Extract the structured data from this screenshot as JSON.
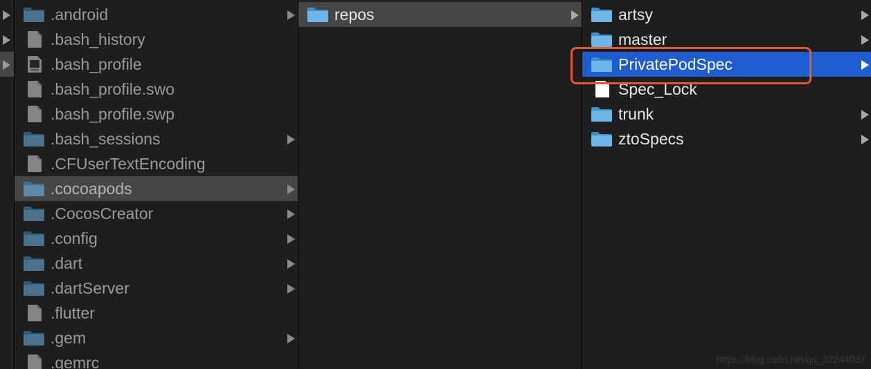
{
  "parent_column": {
    "items": [
      {
        "expandable": true,
        "selected": false
      },
      {
        "expandable": true,
        "selected": false
      },
      {
        "expandable": true,
        "selected": true
      }
    ]
  },
  "home_column": {
    "items": [
      {
        "name": ".android",
        "icon": "folder-icon",
        "expandable": true,
        "selected": false
      },
      {
        "name": ".bash_history",
        "icon": "document-icon",
        "expandable": false,
        "selected": false
      },
      {
        "name": ".bash_profile",
        "icon": "shell-script-icon",
        "expandable": false,
        "selected": false
      },
      {
        "name": ".bash_profile.swo",
        "icon": "document-icon",
        "expandable": false,
        "selected": false
      },
      {
        "name": ".bash_profile.swp",
        "icon": "document-icon",
        "expandable": false,
        "selected": false
      },
      {
        "name": ".bash_sessions",
        "icon": "folder-icon",
        "expandable": true,
        "selected": false
      },
      {
        "name": ".CFUserTextEncoding",
        "icon": "document-icon",
        "expandable": false,
        "selected": false
      },
      {
        "name": ".cocoapods",
        "icon": "folder-icon",
        "expandable": true,
        "selected": true
      },
      {
        "name": ".CocosCreator",
        "icon": "folder-icon",
        "expandable": true,
        "selected": false
      },
      {
        "name": ".config",
        "icon": "folder-icon",
        "expandable": true,
        "selected": false
      },
      {
        "name": ".dart",
        "icon": "folder-icon",
        "expandable": true,
        "selected": false
      },
      {
        "name": ".dartServer",
        "icon": "folder-icon",
        "expandable": true,
        "selected": false
      },
      {
        "name": ".flutter",
        "icon": "document-icon",
        "expandable": false,
        "selected": false
      },
      {
        "name": ".gem",
        "icon": "folder-icon",
        "expandable": true,
        "selected": false
      },
      {
        "name": ".gemrc",
        "icon": "document-icon",
        "expandable": false,
        "selected": false
      }
    ]
  },
  "cocoapods_column": {
    "items": [
      {
        "name": "repos",
        "icon": "folder-icon",
        "expandable": true,
        "selected": true
      }
    ]
  },
  "repos_column": {
    "items": [
      {
        "name": "artsy",
        "icon": "folder-icon",
        "expandable": true,
        "selected": false
      },
      {
        "name": "master",
        "icon": "folder-icon",
        "expandable": true,
        "selected": false
      },
      {
        "name": "PrivatePodSpec",
        "icon": "folder-icon",
        "expandable": true,
        "selected": true,
        "highlighted": true
      },
      {
        "name": "Spec_Lock",
        "icon": "blank-document-icon",
        "expandable": false,
        "selected": false
      },
      {
        "name": "trunk",
        "icon": "folder-icon",
        "expandable": true,
        "selected": false
      },
      {
        "name": "ztoSpecs",
        "icon": "folder-icon",
        "expandable": true,
        "selected": false
      }
    ]
  },
  "colors": {
    "background": "#1e1e1e",
    "selection_active": "#1f5dce",
    "selection_inactive": "#464646",
    "annotation_box": "#e8552a",
    "folder": "#5aaee3"
  },
  "watermark": "https://blog.csdn.net/qq_32244037"
}
